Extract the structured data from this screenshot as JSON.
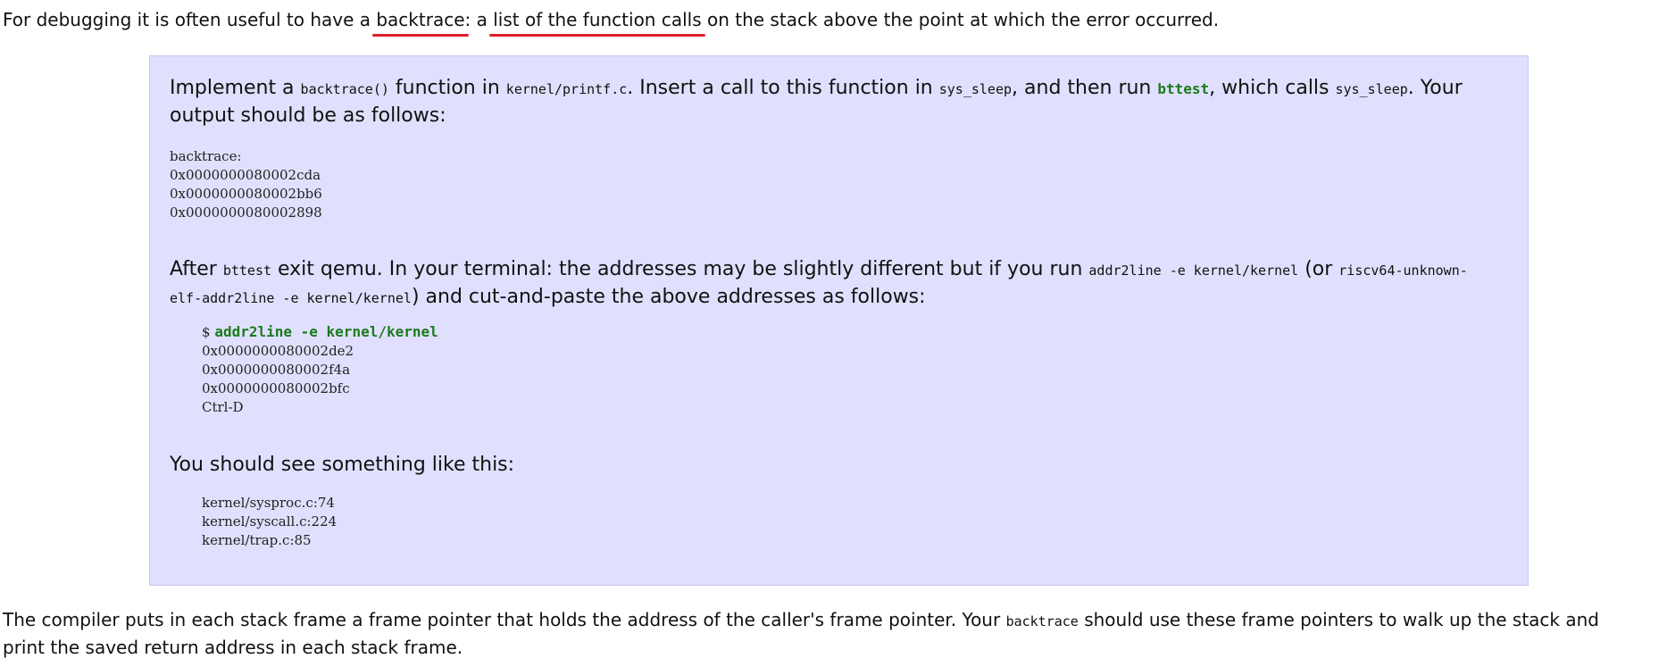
{
  "intro": {
    "before": "For debugging it is often useful to have a ",
    "term": "backtrace",
    "middle": ": a ",
    "phrase": "list of the function calls",
    "after": " on the stack above the point at which the error occurred."
  },
  "box": {
    "line1": {
      "t1": "Implement a ",
      "c1": "backtrace()",
      "t2": " function in ",
      "c2": "kernel/printf.c",
      "t3": ". Insert a call to this function in ",
      "c3": "sys_sleep",
      "t4": ", and then run ",
      "c4": "bttest",
      "t5": ", which calls ",
      "c5": "sys_sleep",
      "t6": ". Your output should be as follows:"
    },
    "output": [
      "backtrace:",
      "0x0000000080002cda",
      "0x0000000080002bb6",
      "0x0000000080002898"
    ],
    "line2": {
      "t1": "After ",
      "c1": "bttest",
      "t2": " exit qemu. In your terminal: the addresses may be slightly different but if you run ",
      "c2": "addr2line -e kernel/kernel",
      "t3": " (or ",
      "c3": "riscv64-unknown-elf-addr2line -e kernel/kernel",
      "t4": ") and cut-and-paste the above addresses as follows:"
    },
    "command": {
      "prompt": "$ ",
      "cmd": "addr2line -e kernel/kernel",
      "lines": [
        "0x0000000080002de2",
        "0x0000000080002f4a",
        "0x0000000080002bfc",
        "Ctrl-D"
      ]
    },
    "line3": "You should see something like this:",
    "result": [
      "kernel/sysproc.c:74",
      "kernel/syscall.c:224",
      "kernel/trap.c:85"
    ]
  },
  "outro": {
    "t1": "The compiler puts in each stack frame a frame pointer that holds the address of the caller's frame pointer. Your ",
    "c1": "backtrace",
    "t2": " should use these frame pointers to walk up the stack and",
    "t3": "print the saved return address in each stack frame."
  },
  "colors": {
    "box_background": "#e0e0fe",
    "code_green": "#1c7a1c",
    "annotation_red": "#e0202a"
  }
}
